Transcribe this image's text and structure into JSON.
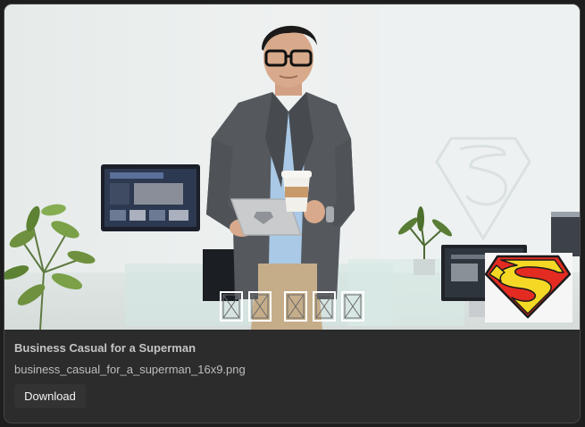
{
  "card": {
    "title": "Business Casual for a Superman",
    "filename": "business_casual_for_a_superman_16x9.png",
    "download_label": "Download"
  },
  "overlay": {
    "glyph_boxes": 5,
    "logo": "superman-shield-icon"
  },
  "colors": {
    "card_bg": "#2c2c2c",
    "button_bg": "#333333",
    "title_text": "#c4c4c4",
    "logo_red": "#e32b22",
    "logo_yellow": "#f5d826"
  }
}
